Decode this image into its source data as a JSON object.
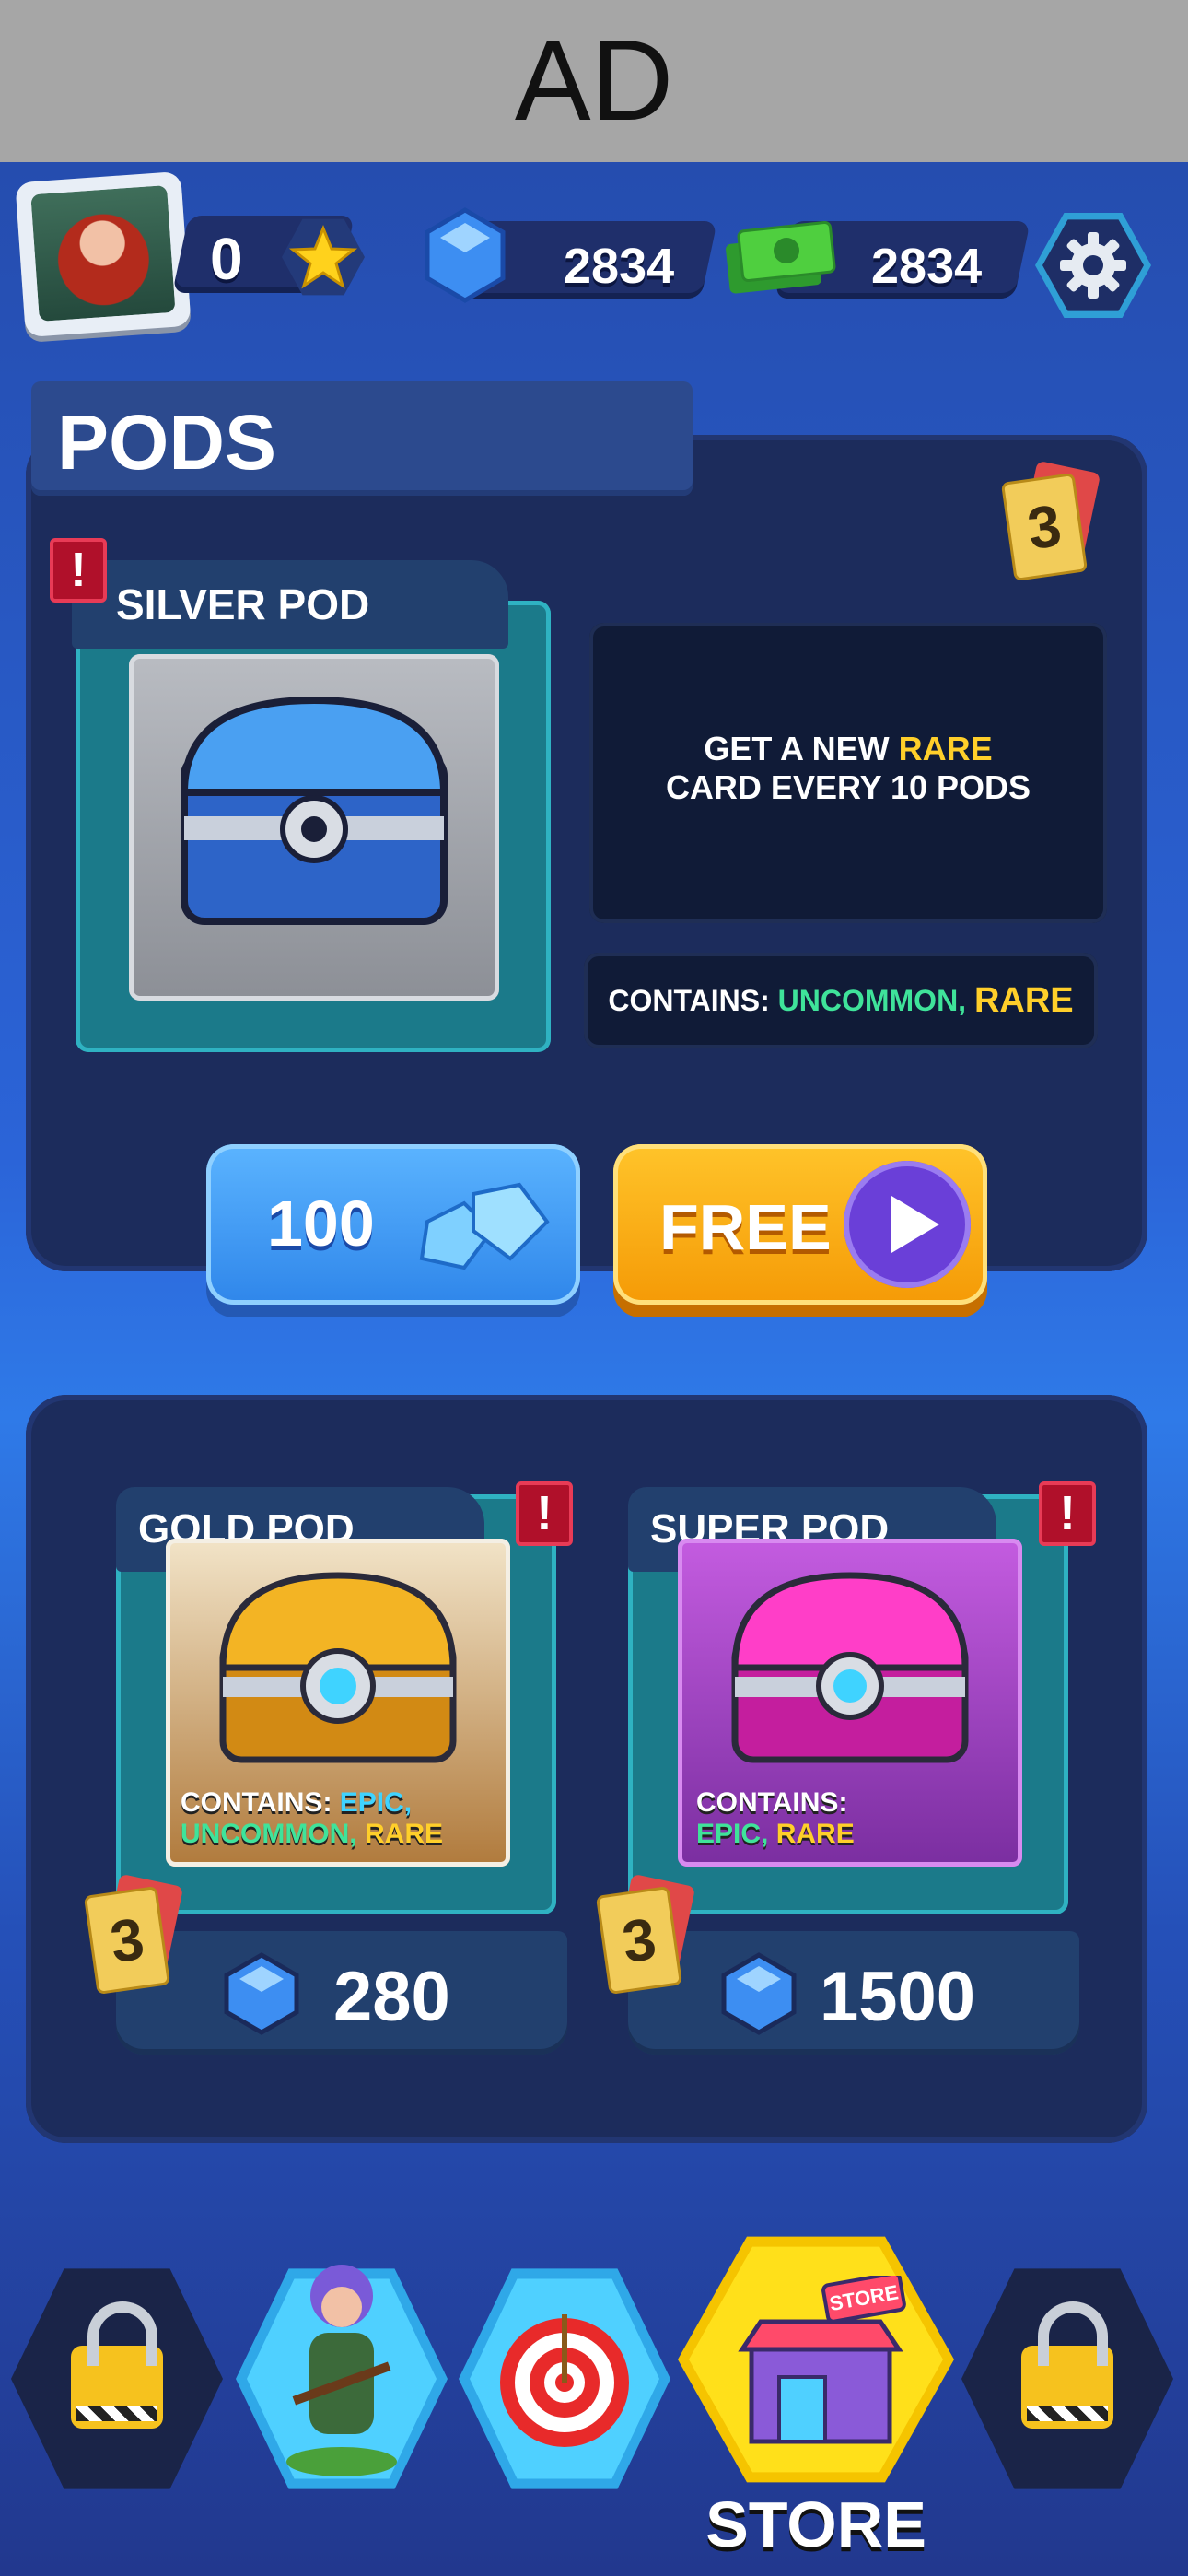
{
  "ad": {
    "label": "AD"
  },
  "hud": {
    "stars": "0",
    "gems": "2834",
    "cash": "2834"
  },
  "pods": {
    "title": "PODS",
    "card_count": "3",
    "silver": {
      "name": "SILVER POD",
      "info_line1_pre": "GET A NEW ",
      "info_line1_rare": "RARE",
      "info_line2": "CARD EVERY 10 PODS",
      "contains_label": "CONTAINS: ",
      "contains_uncommon": "UNCOMMON,",
      "contains_rare": "RARE",
      "price": "100",
      "free_label": "FREE"
    },
    "gold": {
      "name": "GOLD POD",
      "contains_label": "CONTAINS: ",
      "contains_epic": "EPIC,",
      "contains_uncommon": "UNCOMMON,",
      "contains_rare": "RARE",
      "card_count": "3",
      "price": "280"
    },
    "super": {
      "name": "SUPER POD",
      "contains_label": "CONTAINS:",
      "contains_epic": "EPIC,",
      "contains_rare": "RARE",
      "card_count": "3",
      "price": "1500"
    }
  },
  "nav": {
    "store_label": "STORE",
    "store_sign": "STORE"
  },
  "colors": {
    "gem": "#3d8ef2",
    "cash": "#3dbb3d",
    "orange": "#f59a06",
    "uncommon": "#3fe39a",
    "rare": "#ffcf2a",
    "epic": "#3fd3ff"
  }
}
